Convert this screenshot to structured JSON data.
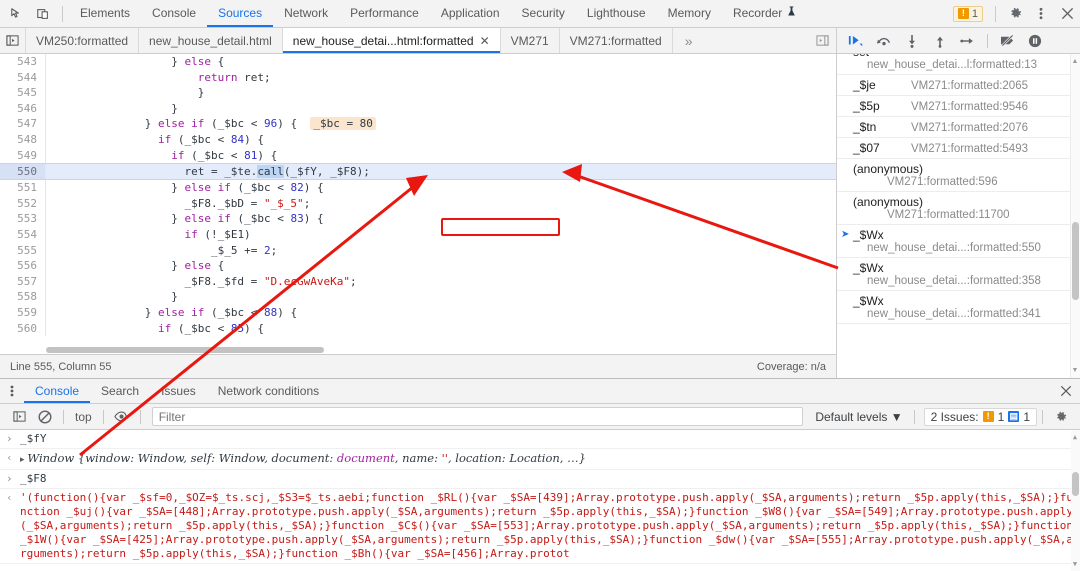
{
  "main_tabs": [
    {
      "label": "Elements",
      "active": false
    },
    {
      "label": "Console",
      "active": false
    },
    {
      "label": "Sources",
      "active": true
    },
    {
      "label": "Network",
      "active": false
    },
    {
      "label": "Performance",
      "active": false
    },
    {
      "label": "Application",
      "active": false
    },
    {
      "label": "Security",
      "active": false
    },
    {
      "label": "Lighthouse",
      "active": false
    },
    {
      "label": "Memory",
      "active": false
    },
    {
      "label": "Recorder",
      "active": false
    }
  ],
  "toolbar": {
    "warning_count": "1",
    "settings_label": "Settings",
    "more_label": "More options",
    "close_label": "Close"
  },
  "file_tabs": [
    {
      "label": "VM250:formatted",
      "active": false,
      "closable": false
    },
    {
      "label": "new_house_detail.html",
      "active": false,
      "closable": false
    },
    {
      "label": "new_house_detai...html:formatted",
      "active": true,
      "closable": true
    },
    {
      "label": "VM271",
      "active": false,
      "closable": false
    },
    {
      "label": "VM271:formatted",
      "active": false,
      "closable": false
    }
  ],
  "file_tab_overflow": "»",
  "editor": {
    "lines": [
      {
        "num": "543",
        "indent": 18,
        "tokens": [
          {
            "t": "} ",
            "c": "plain"
          },
          {
            "t": "else",
            "c": "kw"
          },
          {
            "t": " {",
            "c": "plain"
          }
        ]
      },
      {
        "num": "544",
        "indent": 22,
        "tokens": [
          {
            "t": "return",
            "c": "kw"
          },
          {
            "t": " ret;",
            "c": "plain"
          }
        ]
      },
      {
        "num": "545",
        "indent": 22,
        "tokens": [
          {
            "t": "}",
            "c": "plain"
          }
        ]
      },
      {
        "num": "546",
        "indent": 18,
        "tokens": [
          {
            "t": "}",
            "c": "plain"
          }
        ]
      },
      {
        "num": "547",
        "indent": 14,
        "tokens": [
          {
            "t": "} ",
            "c": "plain"
          },
          {
            "t": "else",
            "c": "kw"
          },
          {
            "t": " ",
            "c": "plain"
          },
          {
            "t": "if",
            "c": "kw"
          },
          {
            "t": " (_$bc < ",
            "c": "plain"
          },
          {
            "t": "96",
            "c": "num"
          },
          {
            "t": ") {",
            "c": "plain"
          }
        ],
        "inline_value": "_$bc = 80"
      },
      {
        "num": "548",
        "indent": 16,
        "tokens": [
          {
            "t": "if",
            "c": "kw"
          },
          {
            "t": " (_$bc < ",
            "c": "plain"
          },
          {
            "t": "84",
            "c": "num"
          },
          {
            "t": ") {",
            "c": "plain"
          }
        ]
      },
      {
        "num": "549",
        "indent": 18,
        "tokens": [
          {
            "t": "if",
            "c": "kw"
          },
          {
            "t": " (_$bc < ",
            "c": "plain"
          },
          {
            "t": "81",
            "c": "num"
          },
          {
            "t": ") {",
            "c": "plain"
          }
        ]
      },
      {
        "num": "550",
        "indent": 20,
        "highlighted": true,
        "tokens": [
          {
            "t": "ret = _$te.",
            "c": "plain"
          },
          {
            "t": "call",
            "c": "sel"
          },
          {
            "t": "(_$fY, _$F8);",
            "c": "plain"
          }
        ]
      },
      {
        "num": "551",
        "indent": 18,
        "tokens": [
          {
            "t": "} ",
            "c": "plain"
          },
          {
            "t": "else",
            "c": "kw"
          },
          {
            "t": " ",
            "c": "plain"
          },
          {
            "t": "if",
            "c": "kw"
          },
          {
            "t": " (_$bc < ",
            "c": "plain"
          },
          {
            "t": "82",
            "c": "num"
          },
          {
            "t": ") {",
            "c": "plain"
          }
        ]
      },
      {
        "num": "552",
        "indent": 20,
        "tokens": [
          {
            "t": "_$F8._$bD = ",
            "c": "plain"
          },
          {
            "t": "\"_$_5\"",
            "c": "str"
          },
          {
            "t": ";",
            "c": "plain"
          }
        ]
      },
      {
        "num": "553",
        "indent": 18,
        "tokens": [
          {
            "t": "} ",
            "c": "plain"
          },
          {
            "t": "else",
            "c": "kw"
          },
          {
            "t": " ",
            "c": "plain"
          },
          {
            "t": "if",
            "c": "kw"
          },
          {
            "t": " (_$bc < ",
            "c": "plain"
          },
          {
            "t": "83",
            "c": "num"
          },
          {
            "t": ") {",
            "c": "plain"
          }
        ]
      },
      {
        "num": "554",
        "indent": 20,
        "tokens": [
          {
            "t": "if",
            "c": "kw"
          },
          {
            "t": " (!_$E1)",
            "c": "plain"
          }
        ]
      },
      {
        "num": "555",
        "indent": 24,
        "tokens": [
          {
            "t": "_$_5 += ",
            "c": "plain"
          },
          {
            "t": "2",
            "c": "num"
          },
          {
            "t": ";",
            "c": "plain"
          }
        ]
      },
      {
        "num": "556",
        "indent": 18,
        "tokens": [
          {
            "t": "} ",
            "c": "plain"
          },
          {
            "t": "else",
            "c": "kw"
          },
          {
            "t": " {",
            "c": "plain"
          }
        ]
      },
      {
        "num": "557",
        "indent": 20,
        "tokens": [
          {
            "t": "_$F8._$fd = ",
            "c": "plain"
          },
          {
            "t": "\"D.ecGwAveKa\"",
            "c": "str"
          },
          {
            "t": ";",
            "c": "plain"
          }
        ]
      },
      {
        "num": "558",
        "indent": 18,
        "tokens": [
          {
            "t": "}",
            "c": "plain"
          }
        ]
      },
      {
        "num": "559",
        "indent": 14,
        "tokens": [
          {
            "t": "} ",
            "c": "plain"
          },
          {
            "t": "else",
            "c": "kw"
          },
          {
            "t": " ",
            "c": "plain"
          },
          {
            "t": "if",
            "c": "kw"
          },
          {
            "t": " (_$bc < ",
            "c": "plain"
          },
          {
            "t": "88",
            "c": "num"
          },
          {
            "t": ") {",
            "c": "plain"
          }
        ]
      },
      {
        "num": "560",
        "indent": 16,
        "tokens": [
          {
            "t": "if",
            "c": "kw"
          },
          {
            "t": " (_$bc < ",
            "c": "plain"
          },
          {
            "t": "85",
            "c": "num"
          },
          {
            "t": ") {",
            "c": "plain"
          }
        ]
      }
    ]
  },
  "editor_status": {
    "cursor": "Line 555, Column 55",
    "coverage": "Coverage: n/a"
  },
  "call_stack": [
    {
      "name": "set",
      "loc": "new_house_detai...l:formatted:13",
      "layout": "stacked",
      "active": false,
      "partial_top": true
    },
    {
      "name": "_$je",
      "loc": "VM271:formatted:2065",
      "layout": "inline",
      "active": false
    },
    {
      "name": "_$5p",
      "loc": "VM271:formatted:9546",
      "layout": "inline",
      "active": false
    },
    {
      "name": "_$tn",
      "loc": "VM271:formatted:2076",
      "layout": "inline",
      "active": false
    },
    {
      "name": "_$07",
      "loc": "VM271:formatted:5493",
      "layout": "inline",
      "active": false
    },
    {
      "name": "(anonymous)",
      "loc": "VM271:formatted:596",
      "layout": "stacked2",
      "active": false
    },
    {
      "name": "(anonymous)",
      "loc": "VM271:formatted:11700",
      "layout": "stacked2",
      "active": false
    },
    {
      "name": "_$Wx",
      "loc": "new_house_detai...:formatted:550",
      "layout": "stacked",
      "active": true
    },
    {
      "name": "_$Wx",
      "loc": "new_house_detai...:formatted:358",
      "layout": "stacked",
      "active": false
    },
    {
      "name": "_$Wx",
      "loc": "new_house_detai...:formatted:341",
      "layout": "stacked",
      "active": false
    }
  ],
  "drawer_tabs": [
    {
      "label": "Console",
      "active": true
    },
    {
      "label": "Search",
      "active": false
    },
    {
      "label": "Issues",
      "active": false
    },
    {
      "label": "Network conditions",
      "active": false
    }
  ],
  "console_toolbar": {
    "context": "top",
    "filter_placeholder": "Filter",
    "filter_value": "",
    "levels": "Default levels ▼",
    "issues_label": "2 Issues:",
    "issues_warn_count": "1",
    "issues_info_count": "1"
  },
  "console_entries": [
    {
      "kind": "input",
      "marker": "›",
      "text": "_$fY"
    },
    {
      "kind": "object",
      "marker": "‹",
      "triangle": "▸",
      "head": "Window",
      "body_parts": [
        {
          "t": " {window: Window, self: Window, document: ",
          "c": "key"
        },
        {
          "t": "document",
          "c": "doc"
        },
        {
          "t": ", name: ",
          "c": "key"
        },
        {
          "t": "''",
          "c": "str"
        },
        {
          "t": ", location: Location, …}",
          "c": "key"
        }
      ]
    },
    {
      "kind": "input",
      "marker": "›",
      "text": "_$F8"
    },
    {
      "kind": "source",
      "marker": "‹",
      "text": "'(function(){var _$sf=0,_$OZ=$_ts.scj,_$S3=$_ts.aebi;function _$RL(){var _$SA=[439];Array.prototype.push.apply(_$SA,arguments);return _$5p.apply(this,_$SA);}function _$uj(){var _$SA=[448];Array.prototype.push.apply(_$SA,arguments);return _$5p.apply(this,_$SA);}function _$W8(){var _$SA=[549];Array.prototype.push.apply(_$SA,arguments);return _$5p.apply(this,_$SA);}function _$C$(){var _$SA=[553];Array.prototype.push.apply(_$SA,arguments);return _$5p.apply(this,_$SA);}function _$1W(){var _$SA=[425];Array.prototype.push.apply(_$SA,arguments);return _$5p.apply(this,_$SA);}function _$dw(){var _$SA=[555];Array.prototype.push.apply(_$SA,arguments);return _$5p.apply(this,_$SA);}function _$Bh(){var _$SA=[456];Array.protot"
    }
  ],
  "colors": {
    "accent": "#1a73e8",
    "annotation": "#e8170f",
    "warning": "#f29900",
    "string": "#c41a16",
    "keyword": "#a020a0",
    "number": "#3232c8",
    "highlight_row": "#e4ecfb",
    "inline_value_bg": "#fbe5cc"
  }
}
